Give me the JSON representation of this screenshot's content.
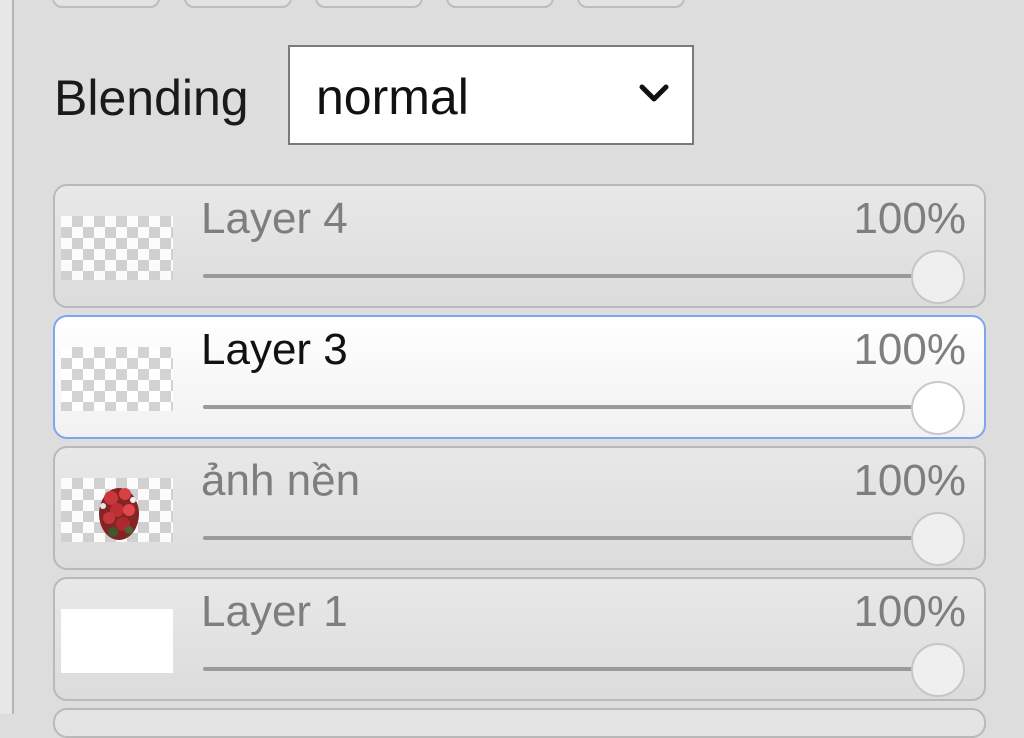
{
  "blending": {
    "label": "Blending",
    "selected": "normal"
  },
  "layers": [
    {
      "name": "Layer 4",
      "opacity": "100%",
      "opacity_value": 100,
      "thumbnail": "transparent",
      "selected": false
    },
    {
      "name": "Layer 3",
      "opacity": "100%",
      "opacity_value": 100,
      "thumbnail": "transparent",
      "selected": true
    },
    {
      "name": "ảnh nền",
      "opacity": "100%",
      "opacity_value": 100,
      "thumbnail": "flower-image",
      "selected": false
    },
    {
      "name": "Layer 1",
      "opacity": "100%",
      "opacity_value": 100,
      "thumbnail": "white",
      "selected": false
    }
  ],
  "colors": {
    "panel_bg": "#dddddd",
    "selected_border": "#7aa7f0"
  }
}
